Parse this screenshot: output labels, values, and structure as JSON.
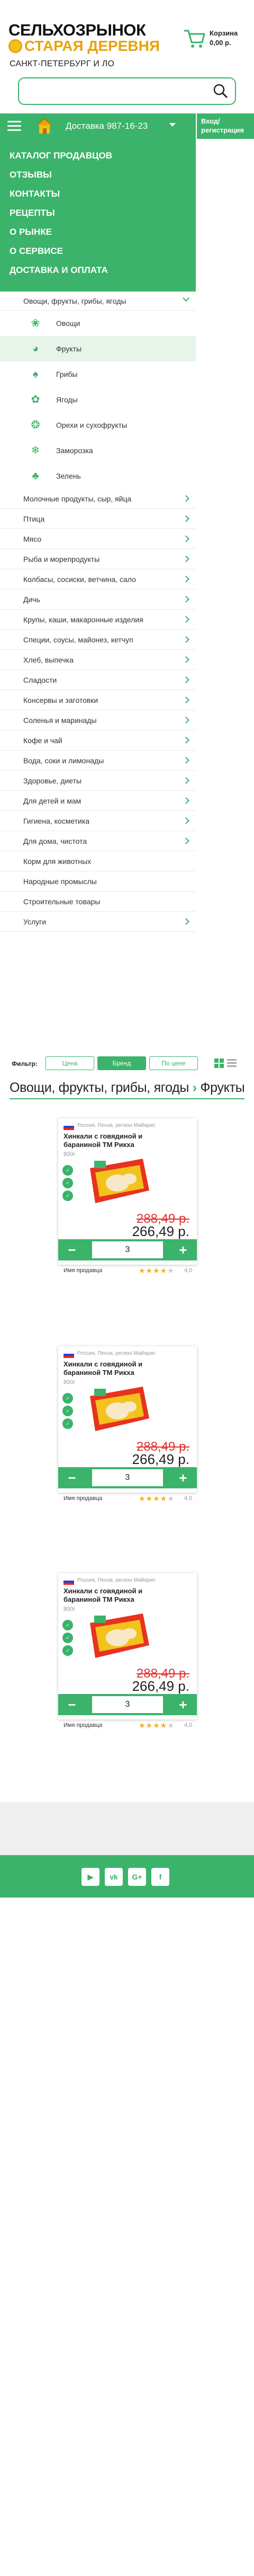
{
  "header": {
    "logo_top": "СЕЛЬХОЗРЫНОК",
    "logo_bottom": "СТАРАЯ ДЕРЕВНЯ",
    "city": "САНКТ-ПЕТЕРБУРГ И ЛО",
    "cart_label": "Корзина",
    "cart_sum": "0,00 р.",
    "search_placeholder": ""
  },
  "nav": {
    "delivery": "Доставка  987-16-23",
    "login_line1": "Вход/",
    "login_line2": "регистрация"
  },
  "menu": [
    "КАТАЛОГ ПРОДАВЦОВ",
    "ОТЗЫВЫ",
    "КОНТАКТЫ",
    "РЕЦЕПТЫ",
    "О РЫНКЕ",
    "О СЕРВИСЕ",
    "ДОСТАВКА И ОПЛАТА"
  ],
  "categories": {
    "open": "Овощи, фрукты, грибы, ягоды",
    "sub": [
      {
        "label": "Овощи",
        "icon": "vegetables-icon"
      },
      {
        "label": "Фрукты",
        "icon": "fruits-icon"
      },
      {
        "label": "Грибы",
        "icon": "mushroom-icon"
      },
      {
        "label": "Ягоды",
        "icon": "berries-icon"
      },
      {
        "label": "Орехи и сухофрукты",
        "icon": "nuts-icon"
      },
      {
        "label": "Заморозка",
        "icon": "snowflake-icon"
      },
      {
        "label": "Зелень",
        "icon": "greens-icon"
      }
    ],
    "list": [
      "Молочные продукты, сыр, яйца",
      "Птица",
      "Мясо",
      "Рыба и морепродукты",
      "Колбасы, сосиски, ветчина, сало",
      "Дичь",
      "Крупы, каши, макаронные изделия",
      "Специи, соусы, майонез, кетчуп",
      "Хлеб, выпечка",
      "Сладости",
      "Консервы и заготовки",
      "Соленья и маринады",
      "Кофе и чай",
      "Вода, соки и лимонады",
      "Здоровье, диеты",
      "Для детей и мам",
      "Гигиена, косметика",
      "Для дома, чистота",
      "Корм для животных",
      "Народные промыслы",
      "Строительные товары",
      "Услуги"
    ],
    "no_arrow": [
      "Корм для животных",
      "Народные промыслы",
      "Строительные товары"
    ]
  },
  "filter": {
    "label": "Фильтр:",
    "price": "Цена",
    "brand": "Бренд",
    "popular": "По цене"
  },
  "breadcrumb": {
    "parent": "Овощи, фрукты, грибы, ягоды",
    "current": "Фрукты"
  },
  "products": [
    {
      "country": "Россия, Пенза, регион Майарис",
      "title": "Хинкали с говядиной и бараниной ТМ Рикха",
      "weight": "800г",
      "old": "288,49 р.",
      "new": "266,49 р.",
      "qty": "3",
      "seller": "Имя продавца",
      "rating": "4,0"
    },
    {
      "country": "Россия, Пенза, регион Майарис",
      "title": "Хинкали с говядиной и бараниной ТМ Рикха",
      "weight": "800г",
      "old": "288,49 р.",
      "new": "266,49 р.",
      "qty": "3",
      "seller": "Имя продавца",
      "rating": "4,0"
    },
    {
      "country": "Россия, Пенза, регион Майарис",
      "title": "Хинкали с говядиной и бараниной ТМ Рикха",
      "weight": "800г",
      "old": "288,49 р.",
      "new": "266,49 р.",
      "qty": "3",
      "seller": "Имя продавца",
      "rating": "4,0"
    }
  ],
  "footer": {
    "social": [
      "youtube-icon",
      "vk-icon",
      "google-plus-icon",
      "facebook-icon"
    ]
  },
  "colors": {
    "accent": "#3bb36a",
    "price_old": "#dd3333",
    "logo_yellow": "#e8a30c"
  }
}
